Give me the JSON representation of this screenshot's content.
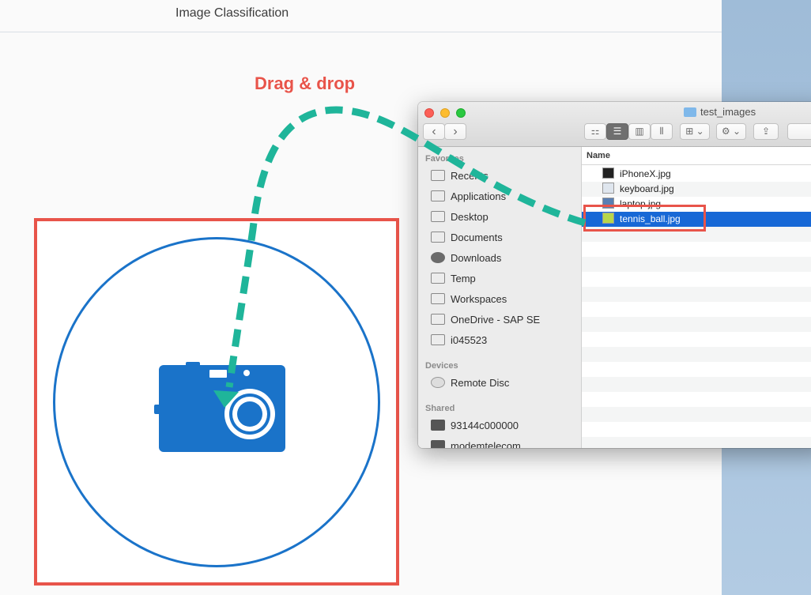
{
  "app": {
    "title": "Image Classification"
  },
  "annotation": {
    "label": "Drag & drop"
  },
  "finder": {
    "window_title": "test_images",
    "toolbar": {
      "back": "‹",
      "forward": "›",
      "view_icon": "⚏",
      "view_list": "☰",
      "view_columns": "▥",
      "view_gallery": "⫴",
      "arrange": "⊞ ⌄",
      "action": "⚙ ⌄",
      "share": "⇪"
    },
    "sidebar": {
      "favorites_label": "Favorites",
      "favorites": [
        "Recents",
        "Applications",
        "Desktop",
        "Documents",
        "Downloads",
        "Temp",
        "Workspaces",
        "OneDrive - SAP SE",
        "i045523"
      ],
      "devices_label": "Devices",
      "devices": [
        "Remote Disc"
      ],
      "shared_label": "Shared",
      "shared": [
        "93144c000000",
        "modemtelecom"
      ]
    },
    "column_header": "Name",
    "files": [
      "iPhoneX.jpg",
      "keyboard.jpg",
      "laptop.jpg",
      "tennis_ball.jpg"
    ],
    "selected_file": "tennis_ball.jpg"
  },
  "colors": {
    "accent_blue": "#1a73c9",
    "highlight_red": "#e8544a",
    "arrow_teal": "#1fb59a",
    "selection_blue": "#1768d6"
  }
}
